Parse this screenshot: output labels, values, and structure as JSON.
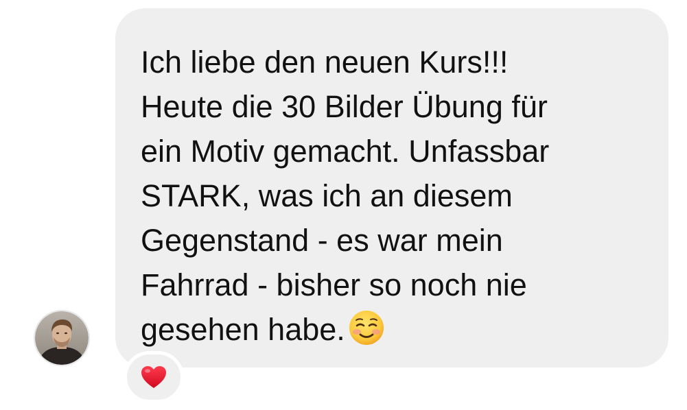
{
  "message": {
    "lines": [
      "Ich liebe den neuen Kurs!!!",
      "Heute die 30 Bilder Übung für",
      "ein Motiv gemacht. Unfassbar",
      "STARK, was ich an diesem",
      "Gegenstand - es war mein",
      "Fahrrad - bisher so noch nie",
      "gesehen habe."
    ],
    "emoji": "smiling-face-icon"
  },
  "reaction": {
    "icon": "heart-icon",
    "color": "#e0132b"
  },
  "sender": {
    "avatar": "avatar"
  },
  "colors": {
    "bubble": "#efefef",
    "text": "#111111",
    "background": "#ffffff"
  }
}
